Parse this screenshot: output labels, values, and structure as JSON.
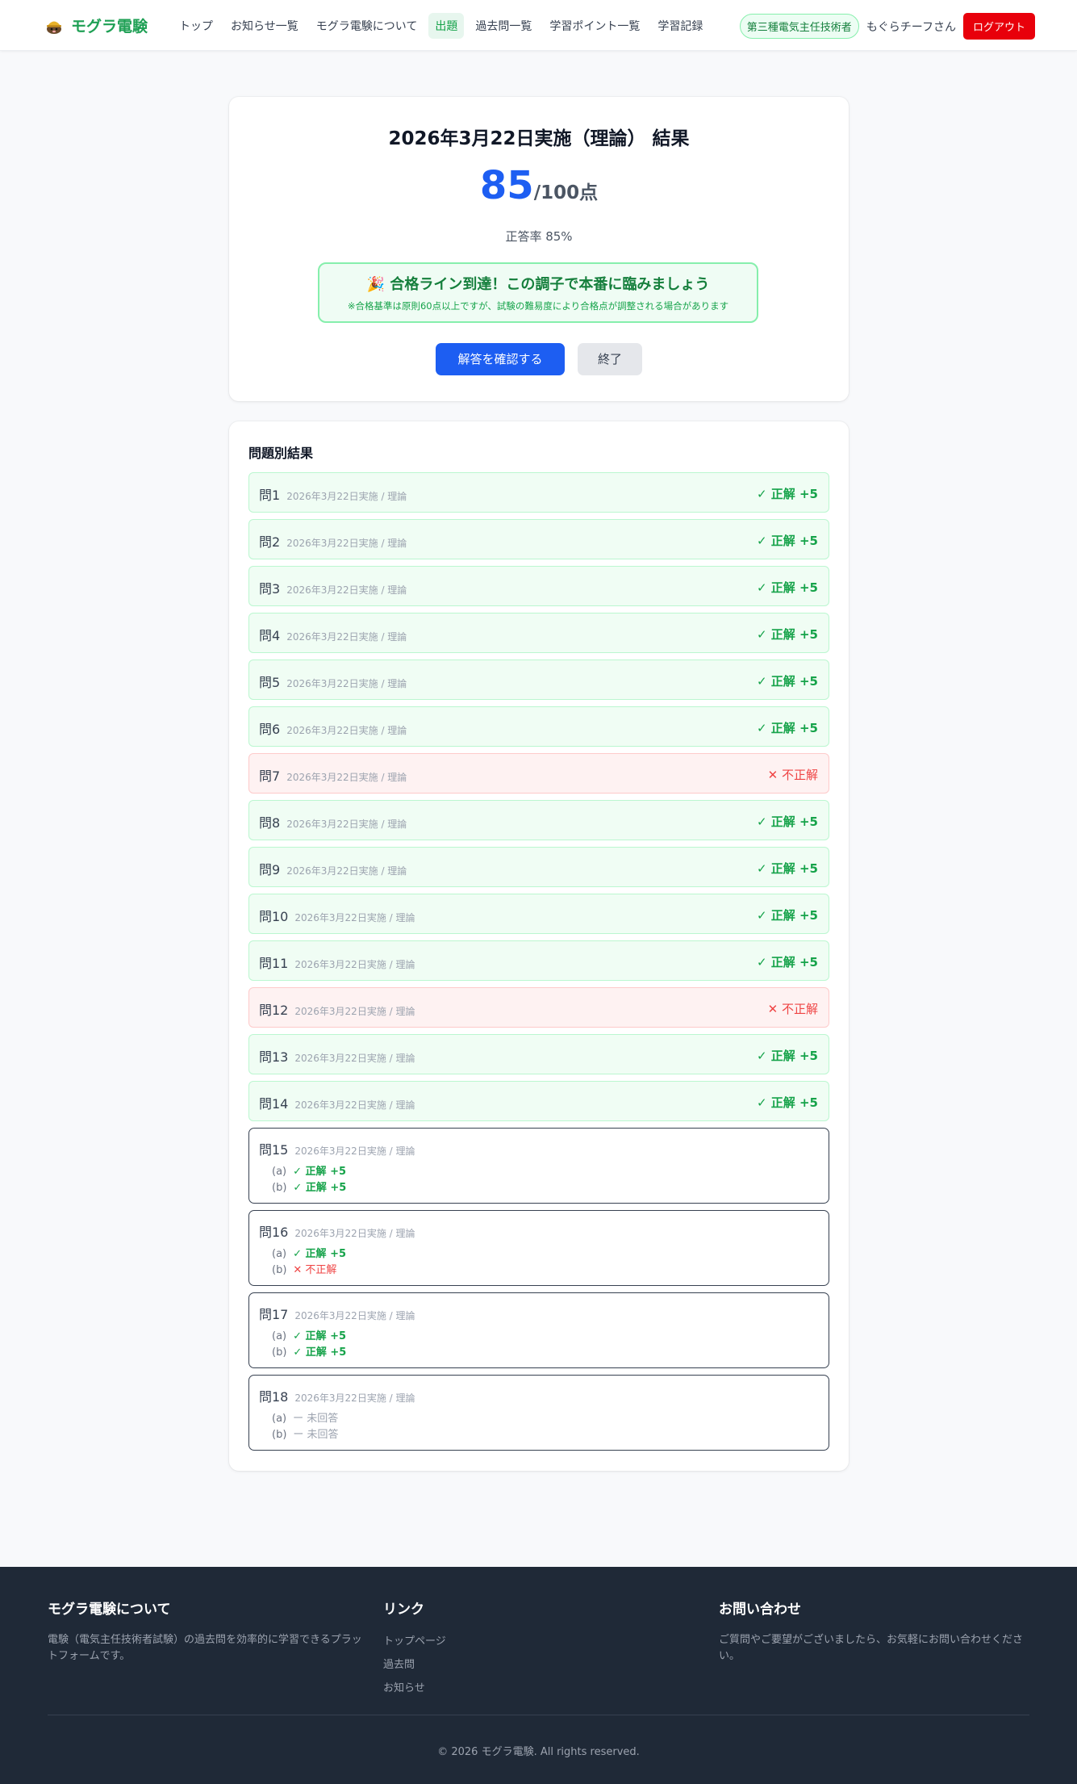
{
  "header": {
    "logo_text": "モグラ電験",
    "nav": [
      "トップ",
      "お知らせ一覧",
      "モグラ電験について",
      "出題",
      "過去問一覧",
      "学習ポイント一覧",
      "学習記録"
    ],
    "active_nav": "出題",
    "level_badge": "第三種電気主任技術者",
    "user_name": "もぐらチーフさん",
    "logout": "ログアウト"
  },
  "result": {
    "title": "2026年3月22日実施（理論） 結果",
    "score": "85",
    "total": "/100点",
    "accuracy": "正答率 85%",
    "pass_message": "🎉 合格ライン到達！この調子で本番に臨みましょう",
    "pass_note": "※合格基準は原則60点以上ですが、試験の難易度により合格点が調整される場合があります",
    "review_button": "解答を確認する",
    "finish_button": "終了"
  },
  "questions": {
    "heading": "問題別結果",
    "meta": "2026年3月22日実施 / 理論",
    "correct_text": "✓ 正解 +5",
    "wrong_text": "✕ 不正解",
    "unanswered_text": "ー 未回答",
    "sub_a": "(a)",
    "sub_b": "(b)",
    "items": [
      {
        "label": "問1",
        "status": "correct"
      },
      {
        "label": "問2",
        "status": "correct"
      },
      {
        "label": "問3",
        "status": "correct"
      },
      {
        "label": "問4",
        "status": "correct"
      },
      {
        "label": "問5",
        "status": "correct"
      },
      {
        "label": "問6",
        "status": "correct"
      },
      {
        "label": "問7",
        "status": "wrong"
      },
      {
        "label": "問8",
        "status": "correct"
      },
      {
        "label": "問9",
        "status": "correct"
      },
      {
        "label": "問10",
        "status": "correct"
      },
      {
        "label": "問11",
        "status": "correct"
      },
      {
        "label": "問12",
        "status": "wrong"
      },
      {
        "label": "問13",
        "status": "correct"
      },
      {
        "label": "問14",
        "status": "correct"
      }
    ],
    "multi": [
      {
        "label": "問15",
        "a": "correct",
        "b": "correct"
      },
      {
        "label": "問16",
        "a": "correct",
        "b": "wrong"
      },
      {
        "label": "問17",
        "a": "correct",
        "b": "correct"
      },
      {
        "label": "問18",
        "a": "unanswered",
        "b": "unanswered"
      }
    ]
  },
  "footer": {
    "about_title": "モグラ電験について",
    "about_text": "電験（電気主任技術者試験）の過去問を効率的に学習できるプラットフォームです。",
    "links_title": "リンク",
    "links": [
      "トップページ",
      "過去問",
      "お知らせ"
    ],
    "contact_title": "お問い合わせ",
    "contact_text": "ご質問やご要望がございましたら、お気軽にお問い合わせください。",
    "copyright": "© 2026 モグラ電験. All rights reserved."
  },
  "colors": {
    "brand": "#1fa055",
    "primary": "#1d5ef2",
    "logout": "#e8000b",
    "correct": "#16a34a",
    "wrong": "#ef4444"
  }
}
